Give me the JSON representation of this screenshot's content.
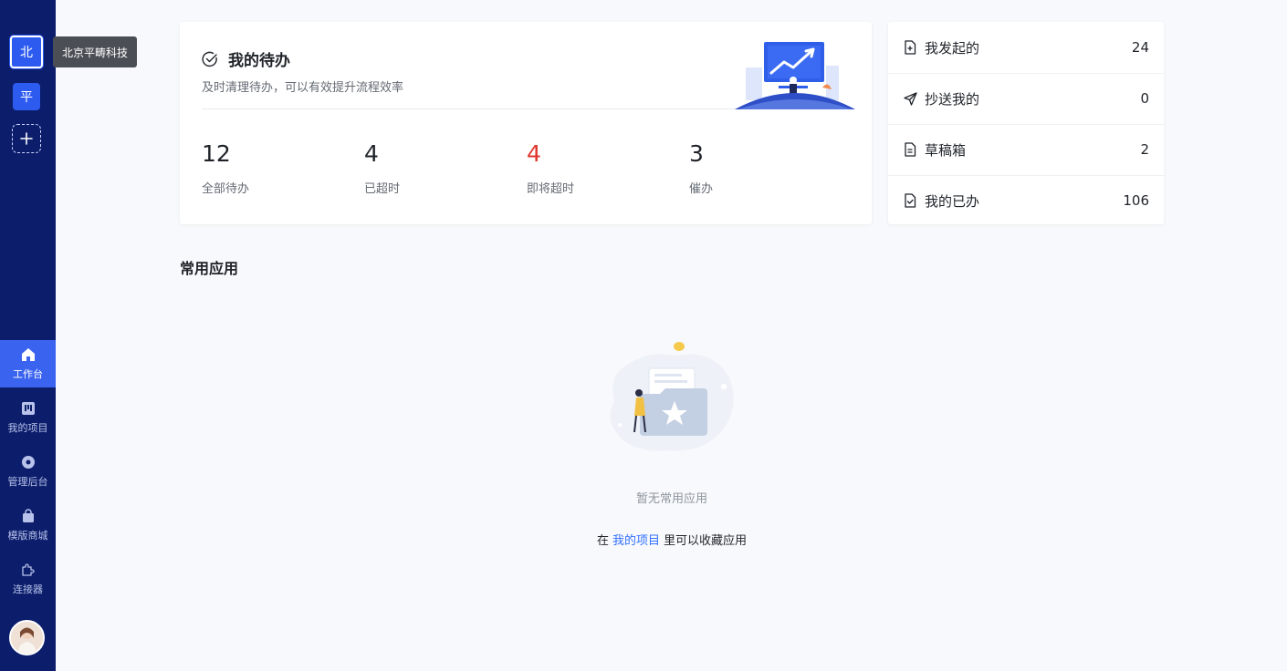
{
  "sidebar": {
    "orgs": [
      {
        "label": "北",
        "tooltip": "北京平畴科技"
      },
      {
        "label": "平"
      }
    ],
    "nav": [
      {
        "label": "工作台",
        "icon": "home-icon",
        "active": true
      },
      {
        "label": "我的项目",
        "icon": "project-board-icon"
      },
      {
        "label": "管理后台",
        "icon": "admin-gear-icon"
      },
      {
        "label": "模版商城",
        "icon": "shopping-bag-icon"
      },
      {
        "label": "连接器",
        "icon": "puzzle-plugin-icon"
      }
    ],
    "colors": {
      "background": "#0b1d6b",
      "active": "#3a63f0"
    }
  },
  "todo": {
    "title": "我的待办",
    "subtitle": "及时清理待办，可以有效提升流程效率",
    "stats": [
      {
        "value": "12",
        "label": "全部待办"
      },
      {
        "value": "4",
        "label": "已超时"
      },
      {
        "value": "4",
        "label": "即将超时",
        "color": "#e0372c"
      },
      {
        "value": "3",
        "label": "催办"
      }
    ]
  },
  "summary": [
    {
      "label": "我发起的",
      "count": "24",
      "icon": "document-add-icon"
    },
    {
      "label": "抄送我的",
      "count": "0",
      "icon": "send-arrow-icon"
    },
    {
      "label": "草稿箱",
      "count": "2",
      "icon": "document-draft-icon"
    },
    {
      "label": "我的已办",
      "count": "106",
      "icon": "document-check-icon"
    }
  ],
  "apps": {
    "title": "常用应用",
    "empty_text": "暂无常用应用",
    "hint_prefix": "在",
    "hint_link": "我的项目",
    "hint_suffix": "里可以收藏应用"
  },
  "accent": "#3370ff"
}
